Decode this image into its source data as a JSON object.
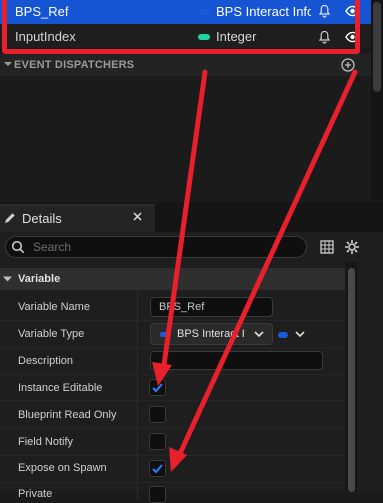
{
  "variables": [
    {
      "name": "BPS_Ref",
      "type": "BPS Interact Info",
      "pin_color": "#1a5ad6",
      "selected": true
    },
    {
      "name": "InputIndex",
      "type": "Integer",
      "pin_color": "#1fd3a5",
      "selected": false
    }
  ],
  "event_dispatchers_label": "EVENT DISPATCHERS",
  "details": {
    "tab_label": "Details",
    "search_placeholder": "Search",
    "category": "Variable",
    "properties": [
      {
        "label": "Variable Name",
        "value": "BPS_Ref"
      },
      {
        "label": "Variable Type",
        "value": "BPS Interact I"
      },
      {
        "label": "Description",
        "value": ""
      },
      {
        "label": "Instance Editable",
        "checked": true
      },
      {
        "label": "Blueprint Read Only",
        "checked": false
      },
      {
        "label": "Field Notify",
        "checked": false
      },
      {
        "label": "Expose on Spawn",
        "checked": true
      },
      {
        "label": "Private",
        "checked": false
      }
    ]
  },
  "colors": {
    "selection": "#1554d2",
    "annotation_red": "#e8202b",
    "check_blue": "#2b7dff"
  }
}
